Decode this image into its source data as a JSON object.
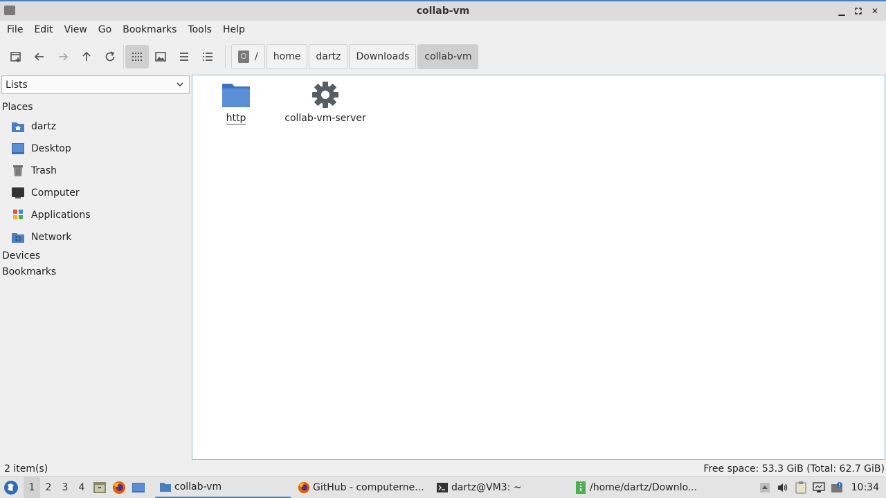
{
  "window": {
    "title": "collab-vm"
  },
  "menubar": {
    "items": [
      "File",
      "Edit",
      "View",
      "Go",
      "Bookmarks",
      "Tools",
      "Help"
    ]
  },
  "breadcrumb": {
    "root": "/",
    "segments": [
      "home",
      "dartz",
      "Downloads",
      "collab-vm"
    ]
  },
  "sidebar": {
    "mode_selected": "Lists",
    "places_heading": "Places",
    "places": [
      {
        "label": "dartz",
        "icon": "home-folder-icon"
      },
      {
        "label": "Desktop",
        "icon": "desktop-icon"
      },
      {
        "label": "Trash",
        "icon": "trash-icon"
      },
      {
        "label": "Computer",
        "icon": "computer-icon"
      },
      {
        "label": "Applications",
        "icon": "applications-icon"
      },
      {
        "label": "Network",
        "icon": "network-icon"
      }
    ],
    "devices_heading": "Devices",
    "bookmarks_heading": "Bookmarks"
  },
  "files": [
    {
      "name": "http",
      "icon": "folder-icon"
    },
    {
      "name": "collab-vm-server",
      "icon": "gear-icon"
    }
  ],
  "status": {
    "item_count": "2 item(s)",
    "free_space": "Free space: 53.3 GiB (Total: 62.7 GiB)"
  },
  "taskbar": {
    "workspaces": [
      "1",
      "2",
      "3",
      "4"
    ],
    "active_workspace": "1",
    "tasks": [
      {
        "label": "collab-vm",
        "icon": "file-manager-icon"
      },
      {
        "label": "GitHub - computerne...",
        "icon": "firefox-icon"
      },
      {
        "label": "dartz@VM3: ~",
        "icon": "terminal-icon"
      },
      {
        "label": "/home/dartz/Downlo...",
        "icon": "archive-icon"
      }
    ],
    "clock": "10:34"
  },
  "colors": {
    "accent": "#4a7fc0",
    "folder": "#5a8fd6",
    "gear": "#555f63"
  }
}
